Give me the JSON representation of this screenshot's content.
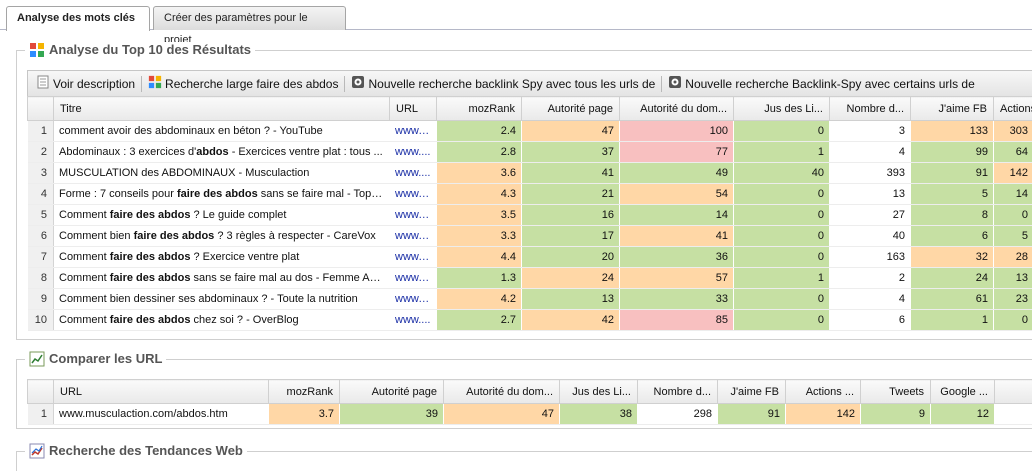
{
  "tabs": [
    {
      "label": "Analyse des mots clés",
      "active": true
    },
    {
      "label": "Créer des paramètres pour le projet",
      "active": false
    }
  ],
  "top10": {
    "title": "Analyse du Top 10 des Résultats",
    "toolbar": [
      {
        "label": "Voir description",
        "icon": "document-icon"
      },
      {
        "label": "Recherche large faire des abdos",
        "icon": "google-icon"
      },
      {
        "label": "Nouvelle recherche backlink Spy avec tous les urls de",
        "icon": "spy-icon"
      },
      {
        "label": "Nouvelle recherche Backlink-Spy avec certains urls de",
        "icon": "spy-icon"
      }
    ],
    "columns": [
      "Titre",
      "URL",
      "mozRank",
      "Autorité page",
      "Autorité du dom...",
      "Jus des Li...",
      "Nombre d...",
      "J'aime FB",
      "Actions ..."
    ],
    "rows": [
      {
        "n": "1",
        "pre": "comment avoir des abdominaux en béton ? - YouTube",
        "kw": "",
        "post": "",
        "url": "www.y...",
        "moz": "2.4",
        "ap": "47",
        "ad": "100",
        "jus": "0",
        "nb": "3",
        "fb": "133",
        "act": "303",
        "c": [
          "g",
          "o",
          "r",
          "g",
          "w",
          "o",
          "o"
        ]
      },
      {
        "n": "2",
        "pre": "Abdominaux : 3 exercices d'",
        "kw": "abdos",
        "post": " - Exercices ventre plat : tous ...",
        "url": "www....",
        "moz": "2.8",
        "ap": "37",
        "ad": "77",
        "jus": "1",
        "nb": "4",
        "fb": "99",
        "act": "64",
        "c": [
          "g",
          "g",
          "r",
          "g",
          "w",
          "g",
          "g"
        ]
      },
      {
        "n": "3",
        "pre": "MUSCULATION des ABDOMINAUX - Musculaction",
        "kw": "",
        "post": "",
        "url": "www....",
        "moz": "3.6",
        "ap": "41",
        "ad": "49",
        "jus": "40",
        "nb": "393",
        "fb": "91",
        "act": "142",
        "c": [
          "o",
          "g",
          "g",
          "g",
          "w",
          "g",
          "o"
        ]
      },
      {
        "n": "4",
        "pre": "Forme : 7 conseils pour ",
        "kw": "faire des abdos",
        "post": " sans se faire mal - Tops...",
        "url": "www.t...",
        "moz": "4.3",
        "ap": "21",
        "ad": "54",
        "jus": "0",
        "nb": "13",
        "fb": "5",
        "act": "14",
        "c": [
          "o",
          "g",
          "o",
          "g",
          "w",
          "g",
          "g"
        ]
      },
      {
        "n": "5",
        "pre": "Comment ",
        "kw": "faire des abdos",
        "post": " ? Le guide complet",
        "url": "www.c...",
        "moz": "3.5",
        "ap": "16",
        "ad": "14",
        "jus": "0",
        "nb": "27",
        "fb": "8",
        "act": "0",
        "c": [
          "o",
          "g",
          "g",
          "g",
          "w",
          "g",
          "g"
        ]
      },
      {
        "n": "6",
        "pre": "Comment bien ",
        "kw": "faire des abdos",
        "post": " ? 3 règles à respecter - CareVox",
        "url": "www.c...",
        "moz": "3.3",
        "ap": "17",
        "ad": "41",
        "jus": "0",
        "nb": "40",
        "fb": "6",
        "act": "5",
        "c": [
          "o",
          "g",
          "o",
          "g",
          "w",
          "g",
          "g"
        ]
      },
      {
        "n": "7",
        "pre": "Comment ",
        "kw": "faire des abdos",
        "post": " ? Exercice ventre plat",
        "url": "www.t...",
        "moz": "4.4",
        "ap": "20",
        "ad": "36",
        "jus": "0",
        "nb": "163",
        "fb": "32",
        "act": "28",
        "c": [
          "o",
          "g",
          "g",
          "g",
          "w",
          "o",
          "o"
        ]
      },
      {
        "n": "8",
        "pre": "Comment ",
        "kw": "faire des abdos",
        "post": " sans se faire mal au dos - Femme Act...",
        "url": "www.f...",
        "moz": "1.3",
        "ap": "24",
        "ad": "57",
        "jus": "1",
        "nb": "2",
        "fb": "24",
        "act": "13",
        "c": [
          "g",
          "o",
          "o",
          "g",
          "w",
          "g",
          "g"
        ]
      },
      {
        "n": "9",
        "pre": "Comment bien dessiner ses abdominaux ? - Toute la nutrition",
        "kw": "",
        "post": "",
        "url": "www.t...",
        "moz": "4.2",
        "ap": "13",
        "ad": "33",
        "jus": "0",
        "nb": "4",
        "fb": "61",
        "act": "23",
        "c": [
          "o",
          "g",
          "g",
          "g",
          "w",
          "g",
          "g"
        ]
      },
      {
        "n": "10",
        "pre": "Comment ",
        "kw": "faire des abdos",
        "post": " chez soi ? - OverBlog",
        "url": "www....",
        "moz": "2.7",
        "ap": "42",
        "ad": "85",
        "jus": "0",
        "nb": "6",
        "fb": "1",
        "act": "0",
        "c": [
          "g",
          "o",
          "r",
          "g",
          "w",
          "g",
          "g"
        ]
      }
    ]
  },
  "compare": {
    "title": "Comparer les URL",
    "columns": [
      "URL",
      "mozRank",
      "Autorité page",
      "Autorité du dom...",
      "Jus des Li...",
      "Nombre d...",
      "J'aime FB",
      "Actions ...",
      "Tweets",
      "Google ..."
    ],
    "rows": [
      {
        "n": "1",
        "url": "www.musculaction.com/abdos.htm",
        "moz": "3.7",
        "ap": "39",
        "ad": "47",
        "jus": "38",
        "nb": "298",
        "fb": "91",
        "act": "142",
        "tw": "9",
        "go": "12",
        "c": [
          "o",
          "g",
          "o",
          "g",
          "w",
          "g",
          "o",
          "g",
          "g"
        ]
      }
    ]
  },
  "trends": {
    "title": "Recherche des Tendances Web"
  },
  "colors": {
    "green": "#c6e0a3",
    "orange": "#ffd7a6",
    "red": "#f8c0c0",
    "link": "#1a2ea6"
  }
}
